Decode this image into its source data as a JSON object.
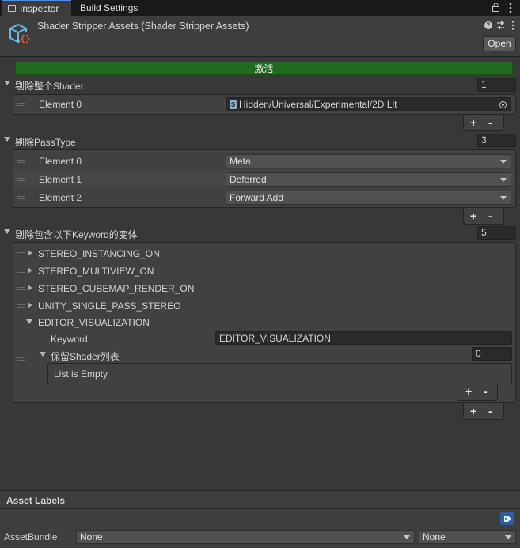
{
  "tabs": [
    {
      "label": "Inspector",
      "active": true
    },
    {
      "label": "Build Settings",
      "active": false
    }
  ],
  "header": {
    "title": "Shader Stripper Assets (Shader Stripper Assets)",
    "open_label": "Open"
  },
  "activate_label": "激活",
  "colors": {
    "activate": "#1e6b1e",
    "accent": "#4d8ee0",
    "background": "#383838"
  },
  "remove_shader": {
    "label": "剔除整个Shader",
    "count": "1",
    "elements": [
      {
        "label": "Element 0",
        "value": "Hidden/Universal/Experimental/2D Lit"
      }
    ]
  },
  "remove_passtype": {
    "label": "剔除PassType",
    "count": "3",
    "elements": [
      {
        "label": "Element 0",
        "value": "Meta"
      },
      {
        "label": "Element 1",
        "value": "Deferred"
      },
      {
        "label": "Element 2",
        "value": "Forward Add"
      }
    ]
  },
  "remove_keyword": {
    "label": "剔除包含以下Keyword的变体",
    "count": "5",
    "items": [
      {
        "label": "STEREO_INSTANCING_ON",
        "expanded": false
      },
      {
        "label": "STEREO_MULTIVIEW_ON",
        "expanded": false
      },
      {
        "label": "STEREO_CUBEMAP_RENDER_ON",
        "expanded": false
      },
      {
        "label": "UNITY_SINGLE_PASS_STEREO",
        "expanded": false
      },
      {
        "label": "EDITOR_VISUALIZATION",
        "expanded": true
      }
    ],
    "expanded_item": {
      "keyword_label": "Keyword",
      "keyword_value": "EDITOR_VISUALIZATION",
      "keep_list_label": "保留Shader列表",
      "keep_list_count": "0",
      "empty_text": "List is Empty"
    }
  },
  "plus": "+",
  "minus": "-",
  "asset_labels": {
    "title": "Asset Labels",
    "assetbundle_label": "AssetBundle",
    "bundle_name": "None",
    "bundle_variant": "None"
  }
}
